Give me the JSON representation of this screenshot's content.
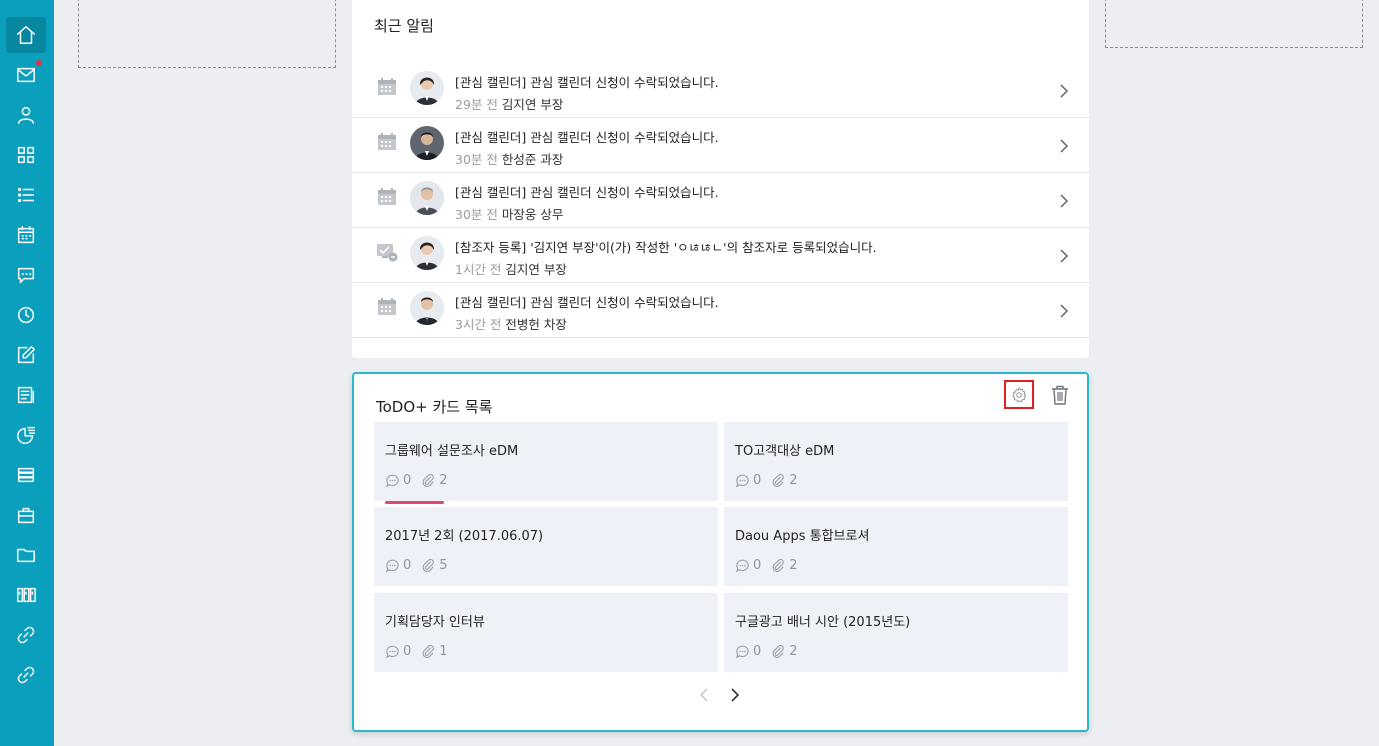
{
  "sidebar": {
    "items": [
      {
        "icon": "home-icon",
        "active": true
      },
      {
        "icon": "mail-icon",
        "badge": true
      },
      {
        "icon": "user-icon"
      },
      {
        "icon": "apps-grid-icon"
      },
      {
        "icon": "list-icon"
      },
      {
        "icon": "calendar-icon"
      },
      {
        "icon": "chat-icon"
      },
      {
        "icon": "clock-icon"
      },
      {
        "icon": "edit-icon"
      },
      {
        "icon": "report-icon"
      },
      {
        "icon": "pie-chart-icon"
      },
      {
        "icon": "stack-icon"
      },
      {
        "icon": "briefcase-icon"
      },
      {
        "icon": "folder-icon"
      },
      {
        "icon": "library-icon"
      },
      {
        "icon": "link-icon"
      },
      {
        "icon": "link-icon"
      }
    ],
    "accent": "#0aa0bd",
    "badge_color": "#e8313f"
  },
  "notifications": {
    "title": "최근 알림",
    "items": [
      {
        "icon": "calendar-icon",
        "message": "[관심 캘린더] 관심 캘린더 신청이 수락되었습니다.",
        "time": "29분 전",
        "who": "김지연 부장"
      },
      {
        "icon": "calendar-icon",
        "message": "[관심 캘린더] 관심 캘린더 신청이 수락되었습니다.",
        "time": "30분 전",
        "who": "한성준 과장"
      },
      {
        "icon": "calendar-icon",
        "message": "[관심 캘린더] 관심 캘린더 신청이 수락되었습니다.",
        "time": "30분 전",
        "who": "마장웅 상무"
      },
      {
        "icon": "reference-icon",
        "message": "[참조자 등록] '김지연 부장'이(가) 작성한 'ㅇㄶㄶㄴ'의 참조자로 등록되었습니다.",
        "time": "1시간 전",
        "who": "김지연 부장"
      },
      {
        "icon": "calendar-icon",
        "message": "[관심 캘린더] 관심 캘린더 신청이 수락되었습니다.",
        "time": "3시간 전",
        "who": "전병헌 차장"
      }
    ]
  },
  "todo": {
    "title": "ToDO+ 카드 목록",
    "accent": "#2ab8cc",
    "cards": [
      {
        "title": "그룹웨어 설문조사 eDM",
        "comments": "0",
        "attachments": "2"
      },
      {
        "title": "TO고객대상 eDM",
        "comments": "0",
        "attachments": "2"
      },
      {
        "title": "2017년 2회 (2017.06.07)",
        "comments": "0",
        "attachments": "5",
        "label_color": "#e2457a"
      },
      {
        "title": "Daou Apps 통합브로셔",
        "comments": "0",
        "attachments": "2"
      },
      {
        "title": "기획담당자 인터뷰",
        "comments": "0",
        "attachments": "1"
      },
      {
        "title": "구글광고 배너 시안 (2015년도)",
        "comments": "0",
        "attachments": "2"
      }
    ]
  }
}
